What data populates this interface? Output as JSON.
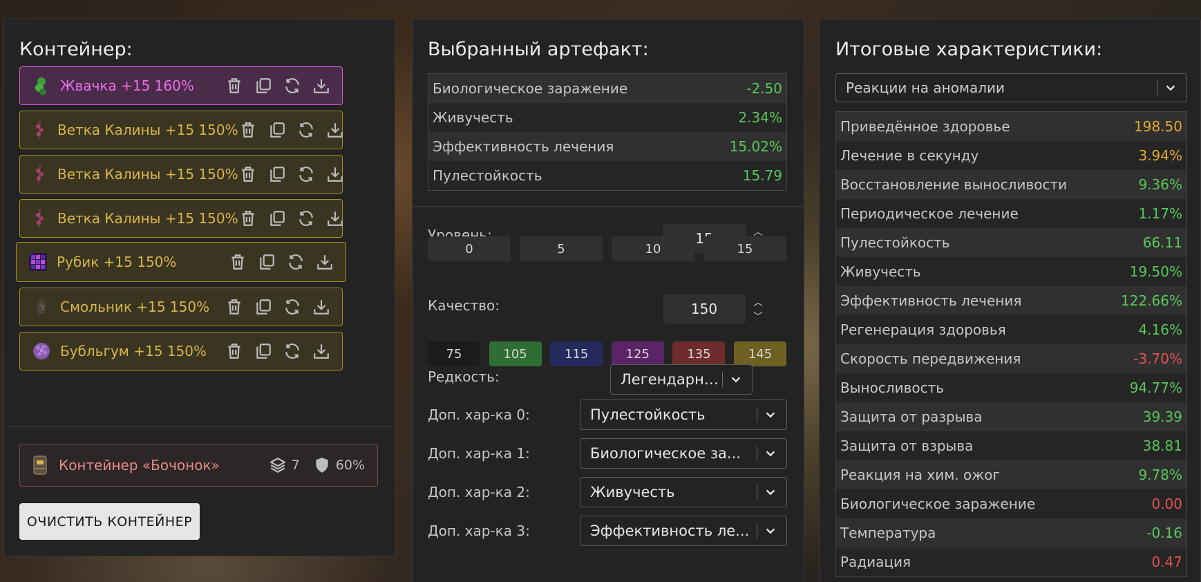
{
  "container_panel": {
    "title": "Контейнер:",
    "items": [
      {
        "label": "Жвачка +15 160%",
        "icon": "gum-artifact-icon",
        "style": "pink"
      },
      {
        "label": "Ветка Калины +15 150%",
        "icon": "viburnum-branch-icon",
        "style": "gold"
      },
      {
        "label": "Ветка Калины +15 150%",
        "icon": "viburnum-branch-icon",
        "style": "gold"
      },
      {
        "label": "Ветка Калины +15 150%",
        "icon": "viburnum-branch-icon",
        "style": "gold"
      },
      {
        "label": "Рубик +15 150%",
        "icon": "rubik-artifact-icon",
        "style": "gold"
      },
      {
        "label": "Смольник +15 150%",
        "icon": "resin-artifact-icon",
        "style": "gold"
      },
      {
        "label": "Бубльгум +15 150%",
        "icon": "bubblegum-artifact-icon",
        "style": "gold"
      }
    ],
    "container": {
      "label": "Контейнер «Бочонок»",
      "slots": "7",
      "protection": "60%"
    },
    "clear_button": "ОЧИСТИТЬ КОНТЕЙНЕР"
  },
  "artifact_panel": {
    "title": "Выбранный артефакт:",
    "stats": [
      {
        "name": "Биологическое заражение",
        "value": "-2.50",
        "color": "#58c75a"
      },
      {
        "name": "Живучесть",
        "value": "2.34%",
        "color": "#58c75a"
      },
      {
        "name": "Эффективность лечения",
        "value": "15.02%",
        "color": "#58c75a"
      },
      {
        "name": "Пулестойкость",
        "value": "15.79",
        "color": "#58c75a"
      }
    ],
    "level_label": "Уровень:",
    "level_value": "15",
    "level_presets": [
      "0",
      "5",
      "10",
      "15"
    ],
    "quality_label": "Качество:",
    "quality_value": "150",
    "quality_presets": [
      {
        "label": "75",
        "color": "#1c1c1c"
      },
      {
        "label": "105",
        "color": "#2e6e34"
      },
      {
        "label": "115",
        "color": "#24295e"
      },
      {
        "label": "125",
        "color": "#5a2466"
      },
      {
        "label": "135",
        "color": "#6e2c2c"
      },
      {
        "label": "145",
        "color": "#6e6020"
      }
    ],
    "rarity_label": "Редкость:",
    "rarity_value": "Легендарный",
    "extras": [
      {
        "label": "Доп. хар-ка 0:",
        "value": "Пулестойкость"
      },
      {
        "label": "Доп. хар-ка 1:",
        "value": "Биологическое за..."
      },
      {
        "label": "Доп. хар-ка 2:",
        "value": "Живучесть"
      },
      {
        "label": "Доп. хар-ка 3:",
        "value": "Эффективность ле..."
      }
    ]
  },
  "totals_panel": {
    "title": "Итоговые характеристики:",
    "filter_value": "Реакции на аномалии",
    "stats": [
      {
        "name": "Приведённое здоровье",
        "value": "198.50",
        "color": "#e3a82c"
      },
      {
        "name": "Лечение в секунду",
        "value": "3.94%",
        "color": "#e3a82c"
      },
      {
        "name": "Восстановление выносливости",
        "value": "9.36%",
        "color": "#58c75a"
      },
      {
        "name": "Периодическое лечение",
        "value": "1.17%",
        "color": "#58c75a"
      },
      {
        "name": "Пулестойкость",
        "value": "66.11",
        "color": "#58c75a"
      },
      {
        "name": "Живучесть",
        "value": "19.50%",
        "color": "#58c75a"
      },
      {
        "name": "Эффективность лечения",
        "value": "122.66%",
        "color": "#58c75a"
      },
      {
        "name": "Регенерация здоровья",
        "value": "4.16%",
        "color": "#58c75a"
      },
      {
        "name": "Скорость передвижения",
        "value": "-3.70%",
        "color": "#e05252"
      },
      {
        "name": "Выносливость",
        "value": "94.77%",
        "color": "#58c75a"
      },
      {
        "name": "Защита от разрыва",
        "value": "39.39",
        "color": "#58c75a"
      },
      {
        "name": "Защита от взрыва",
        "value": "38.81",
        "color": "#58c75a"
      },
      {
        "name": "Реакция на хим. ожог",
        "value": "9.78%",
        "color": "#58c75a"
      },
      {
        "name": "Биологическое заражение",
        "value": "0.00",
        "color": "#e05252"
      },
      {
        "name": "Температура",
        "value": "-0.16",
        "color": "#58c75a"
      },
      {
        "name": "Радиация",
        "value": "0.47",
        "color": "#e05252"
      }
    ]
  }
}
